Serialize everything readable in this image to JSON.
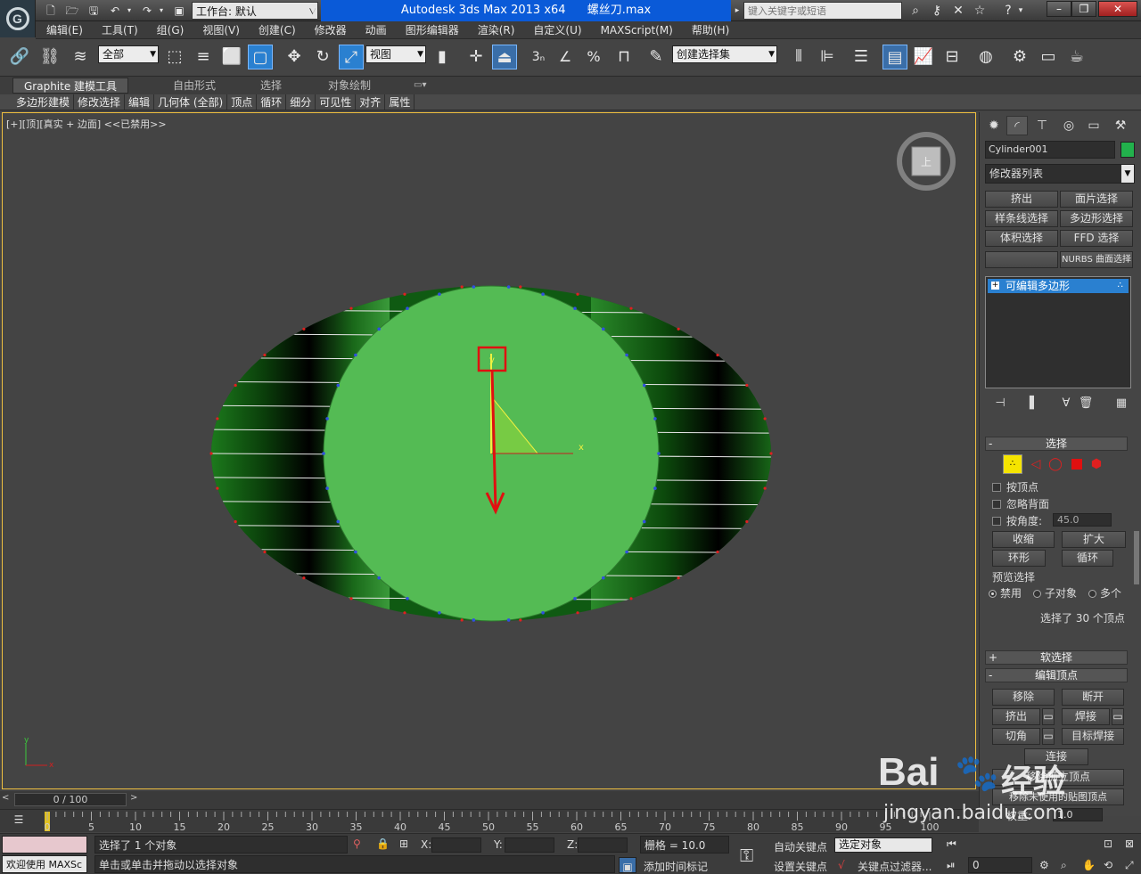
{
  "titlebar": {
    "workspace_label": "工作台: 默认",
    "app_name": "Autodesk 3ds Max  2013 x64",
    "file_name": "螺丝刀.max",
    "search_placeholder": "键入关键字或短语",
    "logo_letter": "G"
  },
  "menu": [
    "编辑(E)",
    "工具(T)",
    "组(G)",
    "视图(V)",
    "创建(C)",
    "修改器",
    "动画",
    "图形编辑器",
    "渲染(R)",
    "自定义(U)",
    "MAXScript(M)",
    "帮助(H)"
  ],
  "toolbar": {
    "filter_value": "全部",
    "ref_coord_value": "视图",
    "selection_set_value": "创建选择集",
    "snap_label": "3",
    "angle_snap_label": "∠",
    "percent_snap_label": "%"
  },
  "ribbon": {
    "tabs": [
      "Graphite 建模工具",
      "自由形式",
      "选择",
      "对象绘制"
    ],
    "sub": [
      "多边形建模",
      "修改选择",
      "编辑",
      "几何体 (全部)",
      "顶点",
      "循环",
      "细分",
      "可见性",
      "对齐",
      "属性"
    ]
  },
  "viewport": {
    "label": "[+][顶][真实 + 边面]  <<已禁用>>",
    "viewcube_label": "上",
    "axis_x": "x",
    "axis_y": "y"
  },
  "panel": {
    "object_name": "Cylinder001",
    "object_color": "#22b14c",
    "modifier_list": "修改器列表",
    "mod_buttons": [
      "挤出",
      "面片选择",
      "样条线选择",
      "多边形选择",
      "体积选择",
      "FFD 选择",
      "",
      "NURBS 曲面选择"
    ],
    "stack_item": "可编辑多边形",
    "selection": {
      "title": "选择",
      "by_vertex": "按顶点",
      "ignore_backface": "忽略背面",
      "by_angle": "按角度:",
      "angle_value": "45.0",
      "shrink": "收缩",
      "grow": "扩大",
      "ring": "环形",
      "loop": "循环",
      "preview_title": "预览选择",
      "preview_off": "禁用",
      "preview_sub": "子对象",
      "preview_multi": "多个",
      "status": "选择了 30 个顶点"
    },
    "soft_selection": "软选择",
    "edit_vertices": {
      "title": "编辑顶点",
      "remove": "移除",
      "break": "断开",
      "extrude": "挤出",
      "weld": "焊接",
      "chamfer": "切角",
      "target_weld": "目标焊接",
      "connect": "连接",
      "remove_isolated": "移除孤立顶点",
      "remove_unused": "移除未使用的贴图顶点",
      "weight_label": "权重:",
      "weight_value": "1.0"
    }
  },
  "timeline": {
    "slider": "0 / 100",
    "ticks": [
      "0",
      "5",
      "10",
      "15",
      "20",
      "25",
      "30",
      "35",
      "40",
      "45",
      "50",
      "55",
      "60",
      "65",
      "70",
      "75",
      "80",
      "85",
      "90",
      "95",
      "100"
    ]
  },
  "status": {
    "welcome": "欢迎使用 MAXSc",
    "selected": "选择了 1 个对象",
    "prompt": "单击或单击并拖动以选择对象",
    "x_label": "X:",
    "y_label": "Y:",
    "z_label": "Z:",
    "grid": "栅格 = 10.0",
    "auto_key": "自动关键点",
    "selected_obj": "选定对象",
    "set_key": "设置关键点",
    "key_filter": "关键点过滤器...",
    "add_time_tag": "添加时间标记",
    "frame": "0"
  },
  "watermark": {
    "brand": "Bai",
    "brand2": "经验",
    "url": "jingyan.baidu.com"
  }
}
